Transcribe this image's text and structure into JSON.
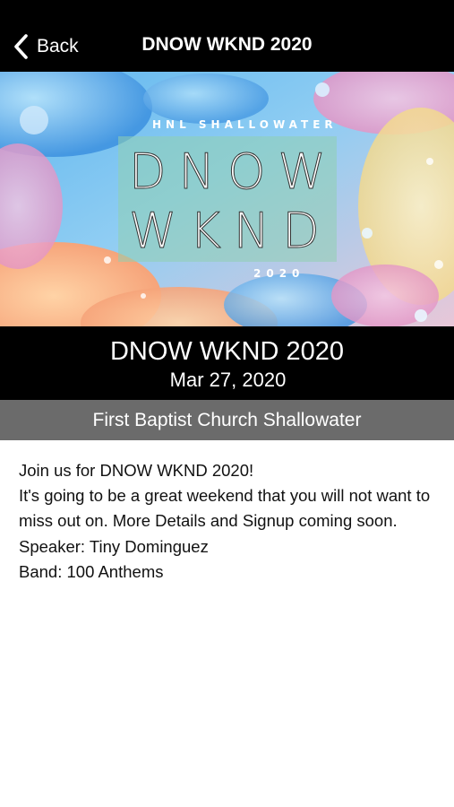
{
  "navbar": {
    "back_label": "Back",
    "title": "DNOW WKND 2020"
  },
  "banner": {
    "org_text": "HNL SHALLOWATER",
    "line1": "DNOW",
    "line2": "WKND",
    "year": "2020"
  },
  "event": {
    "title": "DNOW WKND 2020",
    "date": "Mar 27, 2020",
    "location": "First Baptist Church Shallowater"
  },
  "description": {
    "lines": [
      "Join us for DNOW WKND 2020!",
      "It's going to be a great weekend that you will not want to miss out on. More Details and Signup coming soon.",
      "Speaker: Tiny Dominguez",
      "Band: 100 Anthems"
    ]
  },
  "colors": {
    "navbar_bg": "#000000",
    "location_bar_bg": "#6b6b6b",
    "text_light": "#ffffff",
    "text_dark": "#111111"
  },
  "icons": {
    "back": "chevron-left-icon"
  }
}
